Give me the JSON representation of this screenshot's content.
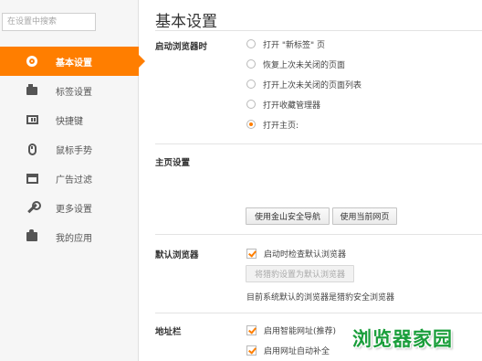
{
  "sidebar": {
    "search_placeholder": "在设置中搜索",
    "items": [
      {
        "label": "基本设置",
        "icon": "gear-icon",
        "active": true
      },
      {
        "label": "标签设置",
        "icon": "tab-icon",
        "active": false
      },
      {
        "label": "快捷键",
        "icon": "keyboard-icon",
        "active": false
      },
      {
        "label": "鼠标手势",
        "icon": "mouse-icon",
        "active": false
      },
      {
        "label": "广告过滤",
        "icon": "ad-filter-icon",
        "active": false
      },
      {
        "label": "更多设置",
        "icon": "wrench-icon",
        "active": false
      },
      {
        "label": "我的应用",
        "icon": "puzzle-icon",
        "active": false
      }
    ]
  },
  "main": {
    "title": "基本设置",
    "startup": {
      "label": "启动浏览器时",
      "options": [
        {
          "label": "打开 \"新标签\" 页",
          "selected": false
        },
        {
          "label": "恢复上次未关闭的页面",
          "selected": false
        },
        {
          "label": "打开上次未关闭的页面列表",
          "selected": false
        },
        {
          "label": "打开收藏管理器",
          "selected": false
        },
        {
          "label": "打开主页:",
          "selected": true
        }
      ]
    },
    "homepage": {
      "label": "主页设置",
      "btn_jinshan_nav": "使用金山安全导航",
      "btn_current_page": "使用当前网页"
    },
    "default_browser": {
      "label": "默认浏览器",
      "check_on_start": "启动时检查默认浏览器",
      "set_default_btn": "将猎豹设置为默认浏览器",
      "status": "目前系统默认的浏览器是猎豹安全浏览器"
    },
    "address_bar": {
      "label": "地址栏",
      "smart_url": "启用智能网址(推荐)",
      "autocomplete": "启用网址自动补全"
    }
  },
  "watermark": "浏览器家园",
  "colors": {
    "accent": "#ff7e00",
    "watermark": "#1a9e3b"
  }
}
